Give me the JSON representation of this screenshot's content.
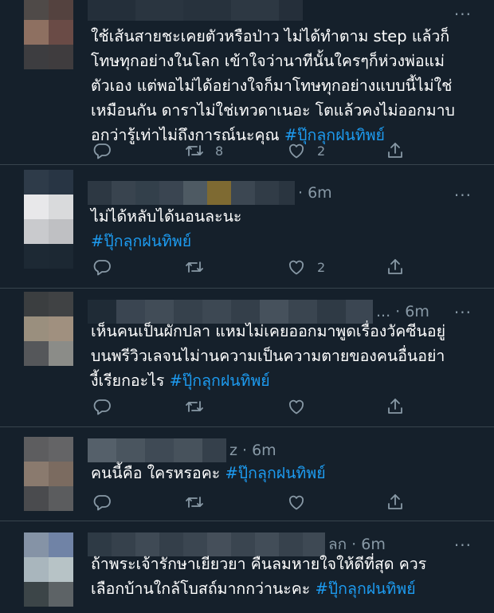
{
  "colors": {
    "background": "#15202b",
    "text": "#ffffff",
    "muted": "#8899a6",
    "hashtag": "#1d9bf0",
    "divider": "#38444d"
  },
  "icons": [
    "reply-icon",
    "retweet-icon",
    "like-icon",
    "share-icon",
    "more-icon"
  ],
  "more_label": "···",
  "tweets": [
    {
      "header_trail": "",
      "text": "ใช้เส้นสายชะเคยตัวหรือป่าว ไม่ได้ทำตาม step แล้วก็\nโทษทุกอย่างในโลก  เข้าใจว่านาทีนั้นใครๆก็ห่วงพ่อแม่\nตัวเอง แต่พอไม่ได้อย่างใจก็มาโทษทุกอย่างแบบนี้ไม่ใช่\nเหมือนกัน  ดาราไม่ใช่เทวดาเนอะ โตแล้วคงไม่ออกมาบ\nอกว่ารู้เท่าไม่ถึงการณ์นะคุณ ",
      "hashtag": "#ปุ๊กลุกฝนทิพย์",
      "reply_count": "",
      "retweet_count": "8",
      "like_count": "2"
    },
    {
      "header_trail": "· 6m",
      "text": "ไม่ได้หลับได้นอนละนะ\n",
      "hashtag": "#ปุ๊กลุกฝนทิพย์",
      "reply_count": "",
      "retweet_count": "",
      "like_count": "2"
    },
    {
      "header_trail": "... · 6m",
      "text": "เห็นคนเป็นผักปลา แหมไม่เคยออกมาพูดเรื่องวัคซีนอยู่\nบนพรีวิวเลจนไม่านความเป็นความตายของคนอื่นอย่า\nงี้เรียกอะไร ",
      "hashtag": "#ปุ๊กลุกฝนทิพย์",
      "reply_count": "",
      "retweet_count": "",
      "like_count": ""
    },
    {
      "header_trail": "z · 6m",
      "text": "คนนี้คือ ใครหรอคะ ",
      "hashtag": "#ปุ๊กลุกฝนทิพย์",
      "reply_count": "",
      "retweet_count": "",
      "like_count": ""
    },
    {
      "header_trail": "ลก · 6m",
      "text": "ถ้าพระเจ้ารักษาเยียวยา คืนลมหายใจให้ดีที่สุด ควร\nเลือกบ้านใกล้โบสถ์มากกว่านะคะ  ",
      "hashtag": "#ปุ๊กลุกฝนทิพย์",
      "reply_count": "",
      "retweet_count": "",
      "like_count": ""
    }
  ]
}
